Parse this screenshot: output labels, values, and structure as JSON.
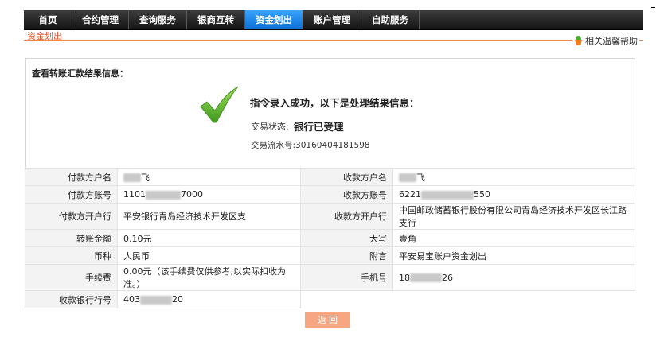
{
  "nav": {
    "tabs": [
      {
        "label": "首页",
        "active": false
      },
      {
        "label": "合约管理",
        "active": false
      },
      {
        "label": "查询服务",
        "active": false
      },
      {
        "label": "银商互转",
        "active": false
      },
      {
        "label": "资金划出",
        "active": true
      },
      {
        "label": "账户管理",
        "active": false
      },
      {
        "label": "自助服务",
        "active": false
      }
    ],
    "active_color": "#1b87e8"
  },
  "breadcrumb": "资金划出",
  "help_link": "相关温馨帮助",
  "result": {
    "title": "查看转账汇款结果信息：",
    "message": "指令录入成功，以下是处理结果信息：",
    "status_label": "交易状态:",
    "status_value": "银行已受理",
    "serial": "交易流水号:30160404181598"
  },
  "details": {
    "payer_name_label": "付款方户名",
    "payer_name": "飞",
    "payee_name_label": "收款方户名",
    "payee_name": "飞",
    "payer_account_label": "付款方账号",
    "payer_account_prefix": "1101",
    "payer_account_suffix": "7000",
    "payee_account_label": "收款方账号",
    "payee_account_prefix": "6221",
    "payee_account_suffix": "550",
    "payer_bank_label": "付款方开户行",
    "payer_bank": "平安银行青岛经济技术开发区支",
    "payee_bank_label": "收款方开户行",
    "payee_bank": "中国邮政储蓄银行股份有限公司青岛经济技术开发区长江路支行",
    "amount_label": "转账金额",
    "amount": "0.10元",
    "uppercase_label": "大写",
    "uppercase": "壹角",
    "currency_label": "币种",
    "currency": "人民币",
    "remark_label": "附言",
    "remark": "平安易宝账户资金划出",
    "fee_label": "手续费",
    "fee": "0.00元（该手续费仅供参考,以实际扣收为准。）",
    "phone_label": "手机号",
    "phone_prefix": "18",
    "phone_suffix": "26",
    "payee_bank_no_label": "收款银行行号",
    "payee_bank_no_prefix": "403",
    "payee_bank_no_suffix": "20"
  },
  "return_button": "返 回",
  "colors": {
    "accent_orange": "#e8542c",
    "button": "#f6a781",
    "check_green": "#5cae2e"
  }
}
